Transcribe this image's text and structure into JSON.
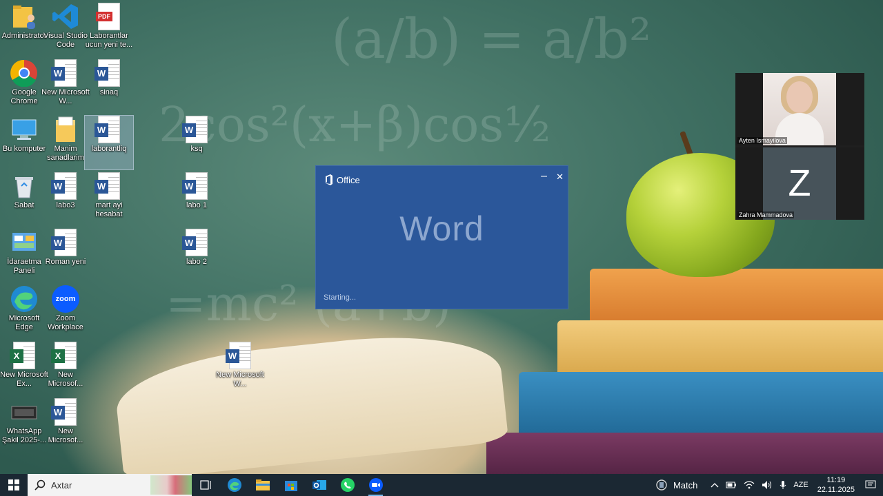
{
  "desktop_icons": [
    {
      "name": "administrator",
      "label": "Administrator",
      "icon": "folder-user-icon"
    },
    {
      "name": "vscode",
      "label": "Visual Studio Code",
      "icon": "vscode-icon"
    },
    {
      "name": "pdf-laborantlar",
      "label": "Laborantlar ucun yeni te...",
      "icon": "pdf-icon",
      "pdf_text": "PDF"
    },
    {
      "name": "chrome",
      "label": "Google Chrome",
      "icon": "chrome-icon"
    },
    {
      "name": "word-new-1",
      "label": "New Microsoft W...",
      "icon": "word-doc-icon"
    },
    {
      "name": "sinaq",
      "label": "sinaq",
      "icon": "word-doc-icon"
    },
    {
      "name": "bu-komputer",
      "label": "Bu komputer",
      "icon": "computer-icon"
    },
    {
      "name": "manim-senedlerim",
      "label": "Manim sanadlarim",
      "icon": "documents-folder-icon"
    },
    {
      "name": "laborantliq",
      "label": "laborantliq",
      "icon": "word-doc-icon"
    },
    {
      "name": "ksq",
      "label": "ksq",
      "icon": "word-doc-icon"
    },
    {
      "name": "sabat",
      "label": "Sabat",
      "icon": "recycle-bin-icon"
    },
    {
      "name": "labo3",
      "label": "labo3",
      "icon": "word-doc-icon"
    },
    {
      "name": "mart-ayi",
      "label": "mart ayi hesabat",
      "icon": "word-doc-icon"
    },
    {
      "name": "labo1",
      "label": "labo 1",
      "icon": "word-doc-icon"
    },
    {
      "name": "idaretme",
      "label": "İdaraetma Paneli",
      "icon": "control-panel-icon"
    },
    {
      "name": "roman-yeni",
      "label": "Roman yeni",
      "icon": "word-doc-icon"
    },
    {
      "name": "labo2",
      "label": "labo 2",
      "icon": "word-doc-icon"
    },
    {
      "name": "edge",
      "label": "Microsoft Edge",
      "icon": "edge-icon"
    },
    {
      "name": "zoom-workplace",
      "label": "Zoom Workplace",
      "icon": "zoom-icon",
      "zoom_text": "zoom"
    },
    {
      "name": "word-new-center",
      "label": "New Microsoft W...",
      "icon": "word-doc-icon"
    },
    {
      "name": "excel-new-1",
      "label": "New Microsoft Ex...",
      "icon": "excel-doc-icon"
    },
    {
      "name": "excel-new-2",
      "label": "New Microsof...",
      "icon": "excel-doc-icon"
    },
    {
      "name": "whatsapp-sekil",
      "label": "WhatsApp Şakil 2025-...",
      "icon": "image-file-icon"
    },
    {
      "name": "word-new-2",
      "label": "New Microsof...",
      "icon": "word-doc-icon"
    }
  ],
  "splash": {
    "brand": "Office",
    "app": "Word",
    "status": "Starting...",
    "minimize": "–",
    "close": "✕"
  },
  "zoom": {
    "participants": [
      {
        "name": "Ayten Ismayilova",
        "type": "video"
      },
      {
        "name": "Zahra Mammadova",
        "type": "avatar",
        "initial": "Z"
      }
    ]
  },
  "taskbar": {
    "search_placeholder": "Axtar",
    "apps": [
      "task-view-icon",
      "edge-icon",
      "file-explorer-icon",
      "microsoft-store-icon",
      "outlook-icon",
      "whatsapp-icon",
      "zoom-icon"
    ],
    "weather_label": "Match",
    "language": "AZE",
    "time": "11:19",
    "date": "22.11.2025"
  },
  "colors": {
    "office_blue": "#2b579a",
    "taskbar": "#1b2833",
    "word_blue": "#2b5797",
    "excel_green": "#1e7145"
  }
}
